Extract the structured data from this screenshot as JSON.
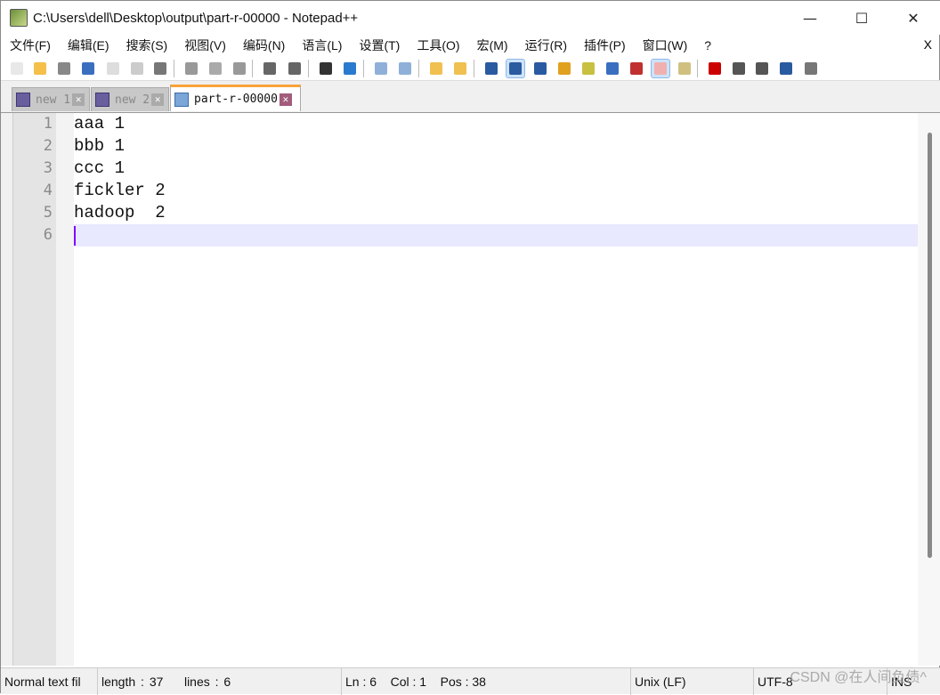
{
  "window": {
    "title": "C:\\Users\\dell\\Desktop\\output\\part-r-00000 - Notepad++",
    "minimize": "—",
    "maximize": "☐",
    "close": "✕"
  },
  "menu": {
    "items": [
      "文件(F)",
      "编辑(E)",
      "搜索(S)",
      "视图(V)",
      "编码(N)",
      "语言(L)",
      "设置(T)",
      "工具(O)",
      "宏(M)",
      "运行(R)",
      "插件(P)",
      "窗口(W)",
      "?"
    ],
    "close": "X"
  },
  "toolbar": {
    "icons": [
      "new-file",
      "open-file",
      "save",
      "save-all",
      "close",
      "close-all",
      "print",
      "cut",
      "copy",
      "paste",
      "undo",
      "redo",
      "find",
      "replace",
      "zoom-in",
      "zoom-out",
      "sync-vertical",
      "sync-horizontal",
      "word-wrap",
      "show-all-chars",
      "indent-guide",
      "user-defined-language",
      "document-map",
      "document-list",
      "function-list",
      "folder-as-workspace",
      "monitoring",
      "record-macro",
      "stop-macro",
      "play-macro",
      "run-macro-multiple",
      "save-macro"
    ]
  },
  "tabs": [
    {
      "label": "new 1",
      "active": false
    },
    {
      "label": "new 2",
      "active": false
    },
    {
      "label": "part-r-00000",
      "active": true
    }
  ],
  "editor": {
    "lines": [
      "aaa 1",
      "bbb 1",
      "ccc 1",
      "fickler 2",
      "hadoop  2",
      ""
    ],
    "current_line": 6
  },
  "status": {
    "type": "Normal text fil",
    "length": "length : 37",
    "lines": "lines : 6",
    "position": "Ln : 6    Col : 1    Pos : 38",
    "eol": "Unix (LF)",
    "encoding": "UTF-8",
    "mode": "INS"
  },
  "watermark": "CSDN @在人间负债^"
}
